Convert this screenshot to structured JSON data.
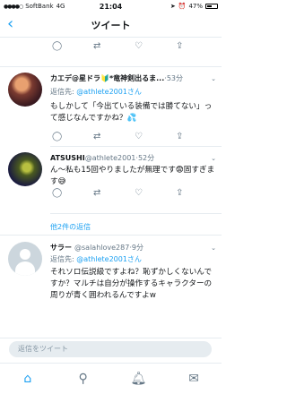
{
  "status_bar": {
    "carrier": "SoftBank",
    "network": "4G",
    "time": "21:04",
    "battery": "47%"
  },
  "nav": {
    "title": "ツイート",
    "back_icon": "chevron-left-icon"
  },
  "tweets": [
    {
      "name": "カエデ@星ドラ🔰*竜神剣出るま...",
      "time": "53分",
      "reply_prefix": "返信先: ",
      "reply_to": "@athlete2001さん",
      "text": "もしかして「今出ている装備では勝てない」って感じなんですかね？💦",
      "retweets": "",
      "likes": ""
    },
    {
      "name": "ATSUSHI",
      "handle": "@athlete2001",
      "time": "52分",
      "text": "ん〜私も15回やりましたが無理です😨固すぎます😅",
      "retweets": "",
      "likes": ""
    },
    {
      "name": "サラー",
      "handle": "@salahlove287",
      "time": "9分",
      "reply_prefix": "返信先: ",
      "reply_to": "@athlete2001さん",
      "text": "それソロ伝説級ですよね？恥ずかしくないんですか？マルチは自分が操作するキャラクターの周りが青く囲われるんですよw"
    }
  ],
  "more_replies": "他2件の返信",
  "reply_bar": {
    "placeholder": "返信をツイート"
  },
  "tabs": [
    {
      "icon": "home-icon"
    },
    {
      "icon": "search-icon"
    },
    {
      "icon": "bell-icon"
    },
    {
      "icon": "mail-icon"
    }
  ]
}
